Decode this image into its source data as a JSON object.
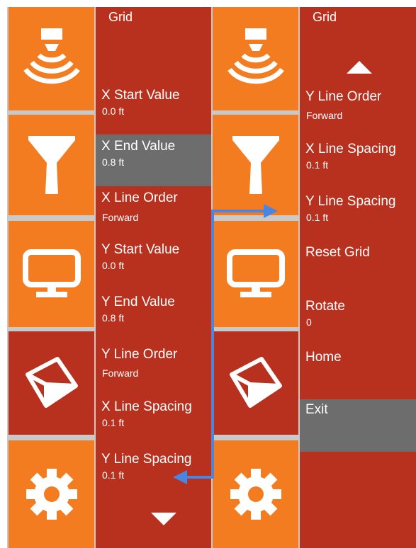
{
  "colors": {
    "tile_orange": "#f47c20",
    "menu_red": "#b8301e",
    "selected_gray": "#6d6d6d",
    "connector_blue": "#4a86e0"
  },
  "icons": [
    "wireless-signal-icon",
    "funnel-filter-icon",
    "monitor-icon",
    "3d-cube-icon",
    "gear-icon"
  ],
  "left_panel": {
    "title": "Grid",
    "items": [
      {
        "label": "X Start Value",
        "value": "0.0 ft"
      },
      {
        "label": "X End Value",
        "value": "0.8 ft",
        "selected": true
      },
      {
        "label": "X Line Order",
        "value": "Forward"
      },
      {
        "label": "Y Start Value",
        "value": "0.0 ft"
      },
      {
        "label": "Y End Value",
        "value": "0.8 ft"
      },
      {
        "label": "Y Line Order",
        "value": "Forward"
      },
      {
        "label": "X Line Spacing",
        "value": "0.1 ft"
      },
      {
        "label": "Y Line Spacing",
        "value": "0.1 ft"
      }
    ]
  },
  "right_panel": {
    "title": "Grid",
    "items": [
      {
        "label": "Y Line Order",
        "value": "Forward"
      },
      {
        "label": "X Line Spacing",
        "value": "0.1 ft"
      },
      {
        "label": "Y Line Spacing",
        "value": "0.1 ft"
      },
      {
        "label": "Reset Grid",
        "value": ""
      },
      {
        "label": "Rotate",
        "value": "0"
      },
      {
        "label": "Home",
        "value": ""
      },
      {
        "label": "Exit",
        "value": "",
        "selected": true
      }
    ]
  }
}
